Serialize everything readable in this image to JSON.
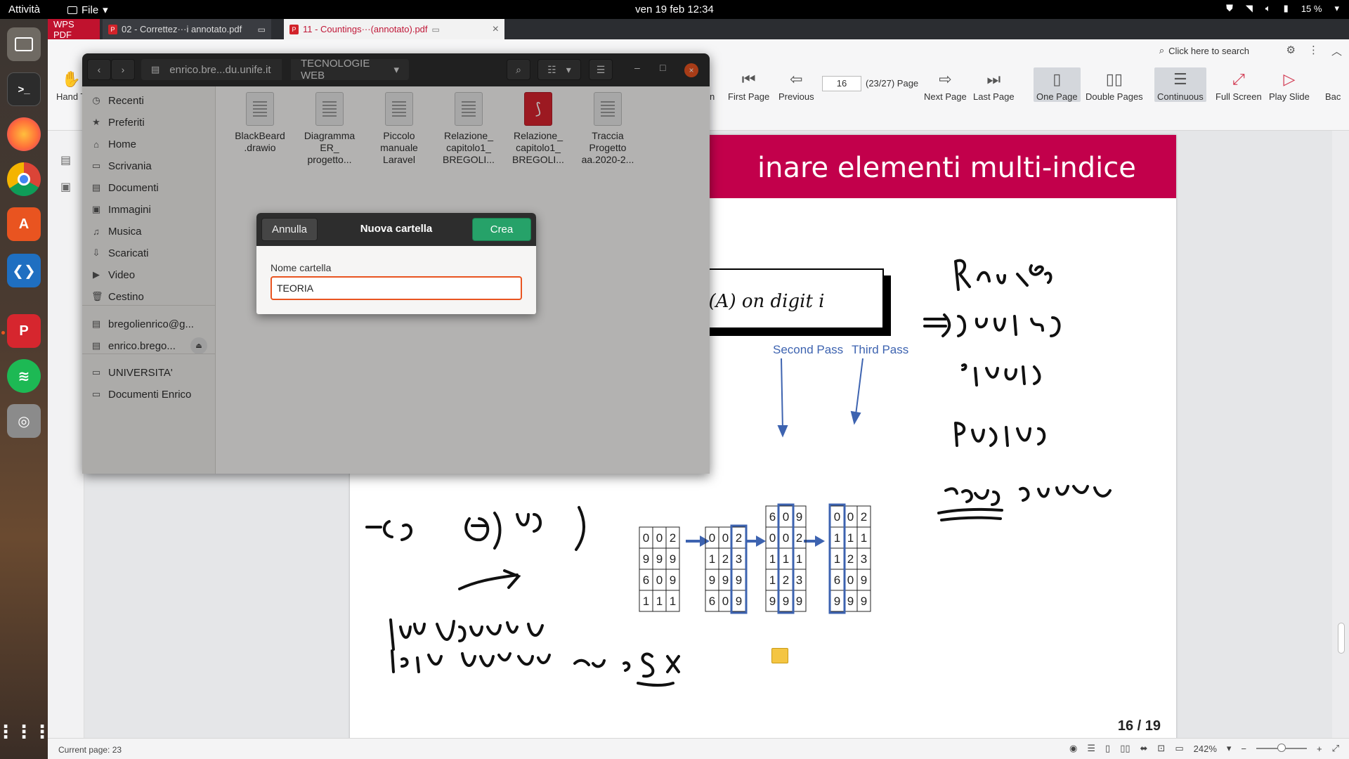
{
  "topbar": {
    "activities": "Attività",
    "app_menu": "File",
    "clock": "ven 19 feb  12:34",
    "battery": "15 %"
  },
  "dock": {
    "apps": [
      "files",
      "terminal",
      "firefox",
      "chrome",
      "software",
      "vscode",
      "wps",
      "spotify",
      "disk",
      "app-grid"
    ]
  },
  "wps": {
    "tabs": [
      {
        "label": "WPS PDF"
      },
      {
        "label": "02 - Correttez···i annotato.pdf"
      },
      {
        "label": "11 - Countings···(annotato).pdf"
      }
    ],
    "menu": {
      "search": "Click here to search"
    },
    "toolbar": {
      "hand": "Hand T",
      "first_page": "First Page",
      "previous": "Previous",
      "page_value": "16",
      "page_count": "(23/27) Page",
      "next_page": "Next Page",
      "last_page": "Last Page",
      "one_page": "One Page",
      "double_pages": "Double Pages",
      "continuous": "Continuous",
      "full_screen": "Full Screen",
      "play_slide": "Play Slide",
      "back": "Bac",
      "cut_n": "n"
    },
    "status": {
      "current_page": "Current page: 23",
      "zoom": "242%"
    }
  },
  "slide": {
    "title": "inare elementi multi-indice",
    "code": "ort(A) on digit i",
    "second_pass": "Second Pass",
    "third_pass": "Third Pass",
    "page_number": "16 / 19",
    "tables": [
      [
        [
          "0",
          "0",
          "2"
        ],
        [
          "9",
          "9",
          "9"
        ],
        [
          "6",
          "0",
          "9"
        ],
        [
          "1",
          "1",
          "1"
        ]
      ],
      [
        [
          "0",
          "0",
          "2"
        ],
        [
          "1",
          "2",
          "3"
        ],
        [
          "9",
          "9",
          "9"
        ],
        [
          "6",
          "0",
          "9"
        ]
      ],
      [
        [
          "6",
          "0",
          "9"
        ],
        [
          "0",
          "0",
          "2"
        ],
        [
          "1",
          "1",
          "1"
        ],
        [
          "1",
          "2",
          "3"
        ],
        [
          "9",
          "9",
          "9"
        ]
      ],
      [
        [
          "0",
          "0",
          "2"
        ],
        [
          "1",
          "1",
          "1"
        ],
        [
          "1",
          "2",
          "3"
        ],
        [
          "6",
          "0",
          "9"
        ],
        [
          "9",
          "9",
          "9"
        ]
      ]
    ]
  },
  "files": {
    "path_host": "enrico.bre...du.unife.it",
    "path_folder": "TECNOLOGIE WEB",
    "sidebar": [
      {
        "label": "Recenti",
        "icon": "clock-icon"
      },
      {
        "label": "Preferiti",
        "icon": "star-icon"
      },
      {
        "label": "Home",
        "icon": "home-icon"
      },
      {
        "label": "Scrivania",
        "icon": "desktop-icon"
      },
      {
        "label": "Documenti",
        "icon": "document-icon"
      },
      {
        "label": "Immagini",
        "icon": "image-icon"
      },
      {
        "label": "Musica",
        "icon": "music-icon"
      },
      {
        "label": "Scaricati",
        "icon": "download-icon"
      },
      {
        "label": "Video",
        "icon": "video-icon"
      },
      {
        "label": "Cestino",
        "icon": "trash-icon"
      },
      {
        "label": "bregolienrico@g...",
        "icon": "network-drive-icon"
      },
      {
        "label": "enrico.brego...",
        "icon": "network-drive-icon"
      },
      {
        "label": "UNIVERSITA'",
        "icon": "folder-icon"
      },
      {
        "label": "Documenti Enrico",
        "icon": "folder-icon"
      }
    ],
    "items": [
      {
        "name": "BlackBeard\n.drawio",
        "type": "doc"
      },
      {
        "name": "Diagramma\nER_\nprogetto...",
        "type": "doc"
      },
      {
        "name": "Piccolo\nmanuale\nLaravel",
        "type": "doc"
      },
      {
        "name": "Relazione_\ncapitolo1_\nBREGOLI...",
        "type": "doc"
      },
      {
        "name": "Relazione_\ncapitolo1_\nBREGOLI...",
        "type": "pdf"
      },
      {
        "name": "Traccia\nProgetto\naa.2020-2...",
        "type": "doc"
      }
    ]
  },
  "dialog": {
    "cancel": "Annulla",
    "title": "Nuova cartella",
    "create": "Crea",
    "label": "Nome cartella",
    "value": "TEORIA"
  },
  "colors": {
    "wps_red": "#c0122e",
    "slide_title_bg": "#c2004b",
    "ubuntu_orange": "#e95420",
    "create_green": "#26a269",
    "diagram_blue": "#3d63b0"
  }
}
